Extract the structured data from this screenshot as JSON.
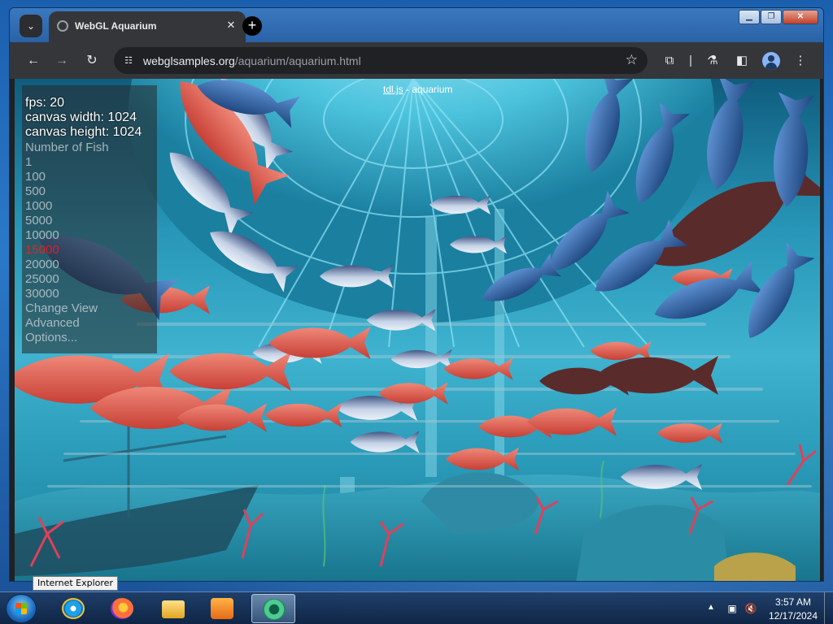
{
  "browser": {
    "tab_title": "WebGL Aquarium",
    "tab_close": "✕",
    "new_tab": "+",
    "url_host": "webglsamples.org",
    "url_path": "/aquarium/aquarium.html"
  },
  "page": {
    "top_link": "tdl.js",
    "top_link_separator": " - ",
    "top_title": "aquarium",
    "stats": {
      "fps": "fps: 20",
      "canvas_width": "canvas width: 1024",
      "canvas_height": "canvas height: 1024"
    },
    "menu": {
      "number_of_fish": "Number of Fish",
      "fish_options": [
        "1",
        "100",
        "500",
        "1000",
        "5000",
        "10000",
        "15000",
        "20000",
        "25000",
        "30000"
      ],
      "selected_option": "15000",
      "change_view": "Change View",
      "advanced": "Advanced",
      "options": "Options..."
    }
  },
  "tooltip": {
    "text": "Internet Explorer"
  },
  "taskbar": {
    "time": "3:57 AM",
    "date": "12/17/2024"
  },
  "colors": {
    "selected_option": "#ff1a1a",
    "water_light": "#3fb3cf",
    "water_dark": "#0f5c7e",
    "red_fish": "#e2574a",
    "blue_fish": "#2c5f9e",
    "dark_fish": "#5a2b2b",
    "coral": "#e0405a"
  },
  "icons": {
    "tab_search": "chevron-down-icon",
    "back": "arrow-left-icon",
    "forward": "arrow-right-icon",
    "reload": "reload-icon",
    "site_info": "tune-icon",
    "bookmark": "star-icon",
    "extensions": "puzzle-icon",
    "labs": "flask-icon",
    "side_panel": "side-panel-icon",
    "menu": "kebab-menu-icon"
  }
}
